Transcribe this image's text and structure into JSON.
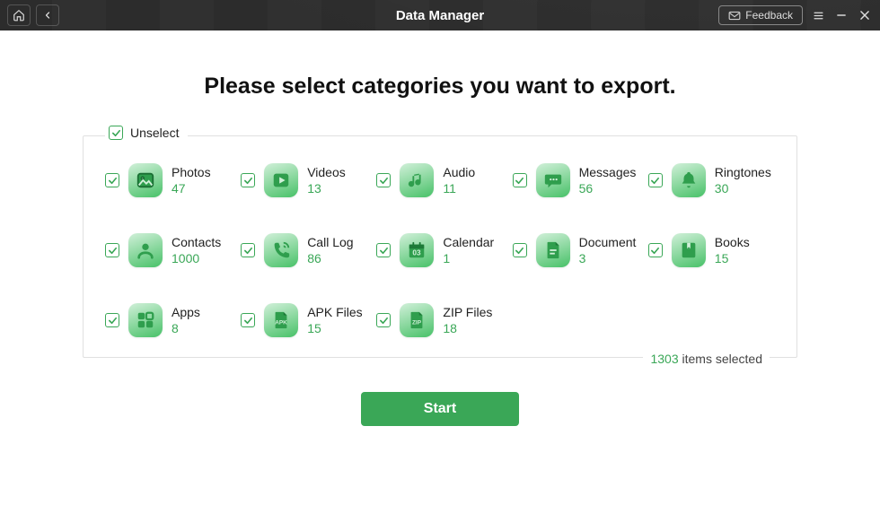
{
  "titlebar": {
    "title": "Data Manager",
    "feedback_label": "Feedback"
  },
  "heading": "Please select categories you want to export.",
  "unselect_label": "Unselect",
  "categories": [
    {
      "label": "Photos",
      "count": "47"
    },
    {
      "label": "Videos",
      "count": "13"
    },
    {
      "label": "Audio",
      "count": "11"
    },
    {
      "label": "Messages",
      "count": "56"
    },
    {
      "label": "Ringtones",
      "count": "30"
    },
    {
      "label": "Contacts",
      "count": "1000"
    },
    {
      "label": "Call Log",
      "count": "86"
    },
    {
      "label": "Calendar",
      "count": "1"
    },
    {
      "label": "Document",
      "count": "3"
    },
    {
      "label": "Books",
      "count": "15"
    },
    {
      "label": "Apps",
      "count": "8"
    },
    {
      "label": "APK Files",
      "count": "15"
    },
    {
      "label": "ZIP Files",
      "count": "18"
    }
  ],
  "summary": {
    "count": "1303",
    "suffix": " items selected"
  },
  "start_label": "Start"
}
